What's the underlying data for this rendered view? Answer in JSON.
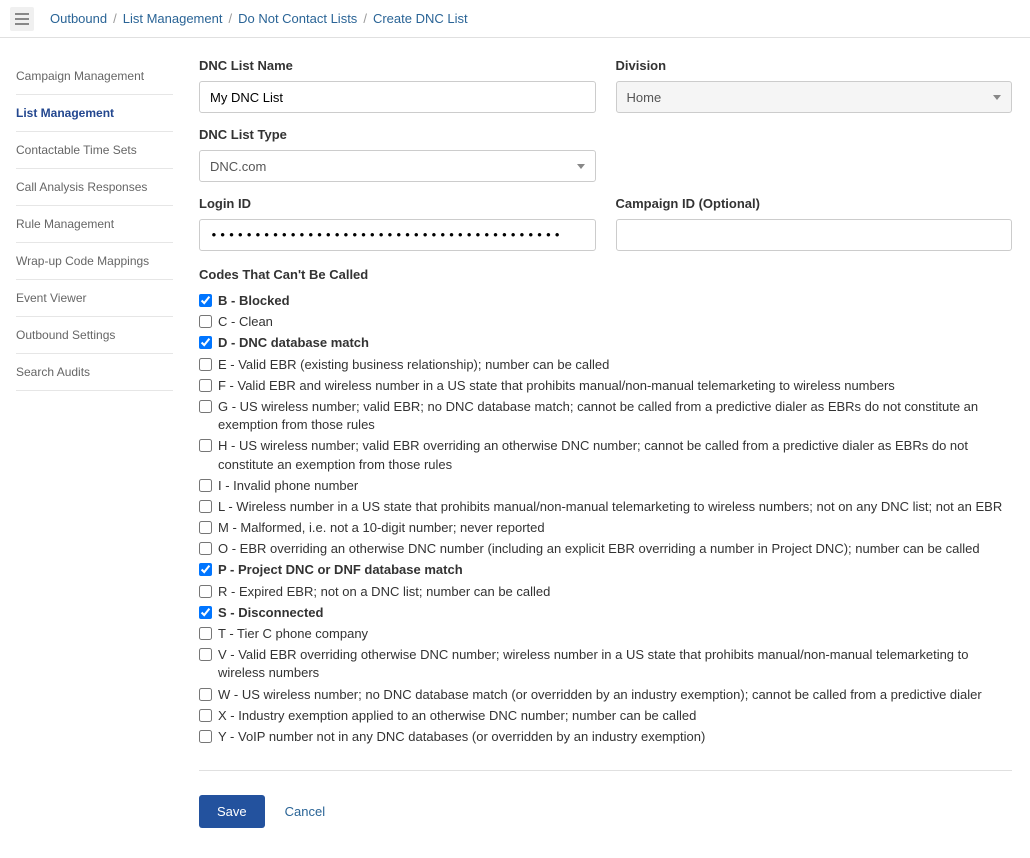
{
  "breadcrumb": [
    "Outbound",
    "List Management",
    "Do Not Contact Lists",
    "Create DNC List"
  ],
  "sidebar": {
    "items": [
      {
        "label": "Campaign Management",
        "active": false
      },
      {
        "label": "List Management",
        "active": true
      },
      {
        "label": "Contactable Time Sets",
        "active": false
      },
      {
        "label": "Call Analysis Responses",
        "active": false
      },
      {
        "label": "Rule Management",
        "active": false
      },
      {
        "label": "Wrap-up Code Mappings",
        "active": false
      },
      {
        "label": "Event Viewer",
        "active": false
      },
      {
        "label": "Outbound Settings",
        "active": false
      },
      {
        "label": "Search Audits",
        "active": false
      }
    ]
  },
  "form": {
    "dnc_name_label": "DNC List Name",
    "dnc_name_value": "My DNC List",
    "division_label": "Division",
    "division_value": "Home",
    "type_label": "DNC List Type",
    "type_value": "DNC.com",
    "login_label": "Login ID",
    "login_value": "••••••••••••••••••••••••••••••••••••••••",
    "campaign_label": "Campaign ID (Optional)",
    "campaign_value": ""
  },
  "codes": {
    "title": "Codes That Can't Be Called",
    "items": [
      {
        "checked": true,
        "label": "B - Blocked"
      },
      {
        "checked": false,
        "label": "C - Clean"
      },
      {
        "checked": true,
        "label": "D - DNC database match"
      },
      {
        "checked": false,
        "label": "E - Valid EBR (existing business relationship); number can be called"
      },
      {
        "checked": false,
        "label": "F - Valid EBR and wireless number in a US state that prohibits manual/non-manual telemarketing to wireless numbers"
      },
      {
        "checked": false,
        "label": "G - US wireless number; valid EBR; no DNC database match; cannot be called from a predictive dialer as EBRs do not constitute an exemption from those rules"
      },
      {
        "checked": false,
        "label": "H - US wireless number; valid EBR overriding an otherwise DNC number; cannot be called from a predictive dialer as EBRs do not constitute an exemption from those rules"
      },
      {
        "checked": false,
        "label": "I - Invalid phone number"
      },
      {
        "checked": false,
        "label": "L - Wireless number in a US state that prohibits manual/non-manual telemarketing to wireless numbers; not on any DNC list; not an EBR"
      },
      {
        "checked": false,
        "label": "M - Malformed, i.e. not a 10-digit number; never reported"
      },
      {
        "checked": false,
        "label": "O - EBR overriding an otherwise DNC number (including an explicit EBR overriding a number in Project DNC); number can be called"
      },
      {
        "checked": true,
        "label": "P - Project DNC or DNF database match"
      },
      {
        "checked": false,
        "label": "R - Expired EBR; not on a DNC list; number can be called"
      },
      {
        "checked": true,
        "label": "S - Disconnected"
      },
      {
        "checked": false,
        "label": "T - Tier C phone company"
      },
      {
        "checked": false,
        "label": "V - Valid EBR overriding otherwise DNC number; wireless number in a US state that prohibits manual/non-manual telemarketing to wireless numbers"
      },
      {
        "checked": false,
        "label": "W - US wireless number; no DNC database match (or overridden by an industry exemption); cannot be called from a predictive dialer"
      },
      {
        "checked": false,
        "label": "X - Industry exemption applied to an otherwise DNC number; number can be called"
      },
      {
        "checked": false,
        "label": "Y - VoIP number not in any DNC databases (or overridden by an industry exemption)"
      }
    ]
  },
  "actions": {
    "save": "Save",
    "cancel": "Cancel"
  }
}
